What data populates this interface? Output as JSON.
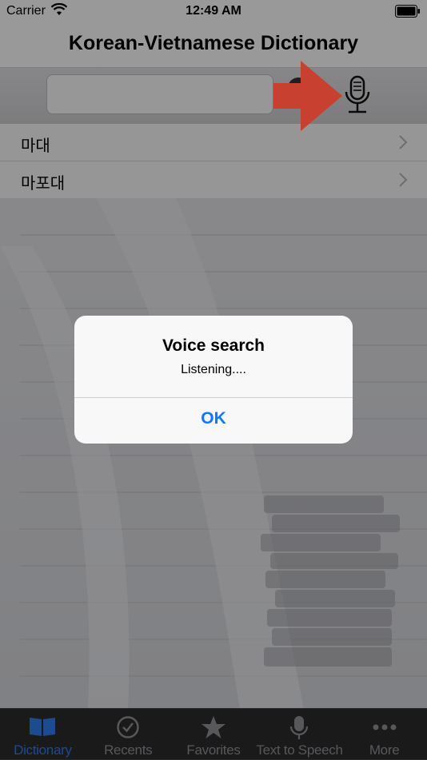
{
  "status_bar": {
    "carrier": "Carrier",
    "time": "12:49 AM"
  },
  "nav": {
    "title": "Korean-Vietnamese Dictionary"
  },
  "search": {
    "value": ""
  },
  "results": [
    {
      "label": "마대"
    },
    {
      "label": "마포대"
    }
  ],
  "alert": {
    "title": "Voice search",
    "message": "Listening....",
    "ok_label": "OK"
  },
  "tabs": [
    {
      "label": "Dictionary",
      "icon": "book-icon",
      "active": true
    },
    {
      "label": "Recents",
      "icon": "clock-icon",
      "active": false
    },
    {
      "label": "Favorites",
      "icon": "star-icon",
      "active": false
    },
    {
      "label": "Text to Speech",
      "icon": "microphone-icon",
      "active": false
    },
    {
      "label": "More",
      "icon": "more-dots-icon",
      "active": false
    }
  ],
  "colors": {
    "accent": "#2f7ae5",
    "alert_button": "#0a7aff",
    "arrow": "#d9412f"
  }
}
